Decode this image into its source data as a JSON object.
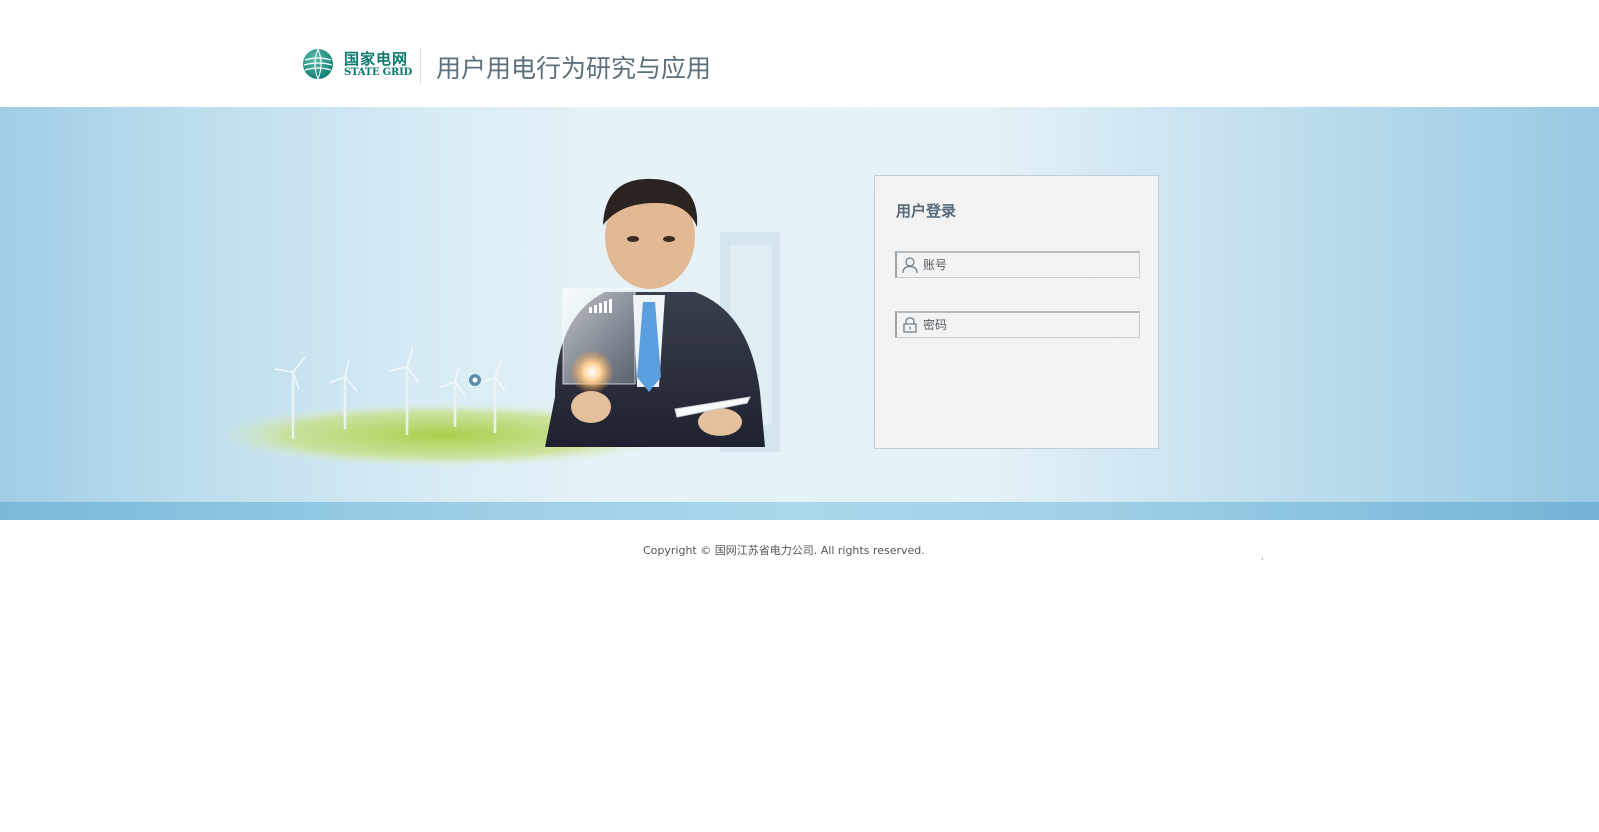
{
  "header": {
    "logo_cn": "国家电网",
    "logo_en": "STATE GRID",
    "system_title": "用户用电行为研究与应用"
  },
  "login": {
    "title": "用户登录",
    "username_placeholder": "账号",
    "username_value": "",
    "password_placeholder": "密码",
    "password_value": "",
    "username_icon": "user-icon",
    "password_icon": "lock-icon"
  },
  "footer": {
    "copyright": "Copyright © 国网江苏省电力公司. All rights reserved.",
    "dot": ","
  },
  "colors": {
    "brand_green": "#0a7a6f",
    "title_gray": "#5b6f7c",
    "banner_blue": "#a0cde6",
    "stripe_blue": "#7ab8da"
  }
}
